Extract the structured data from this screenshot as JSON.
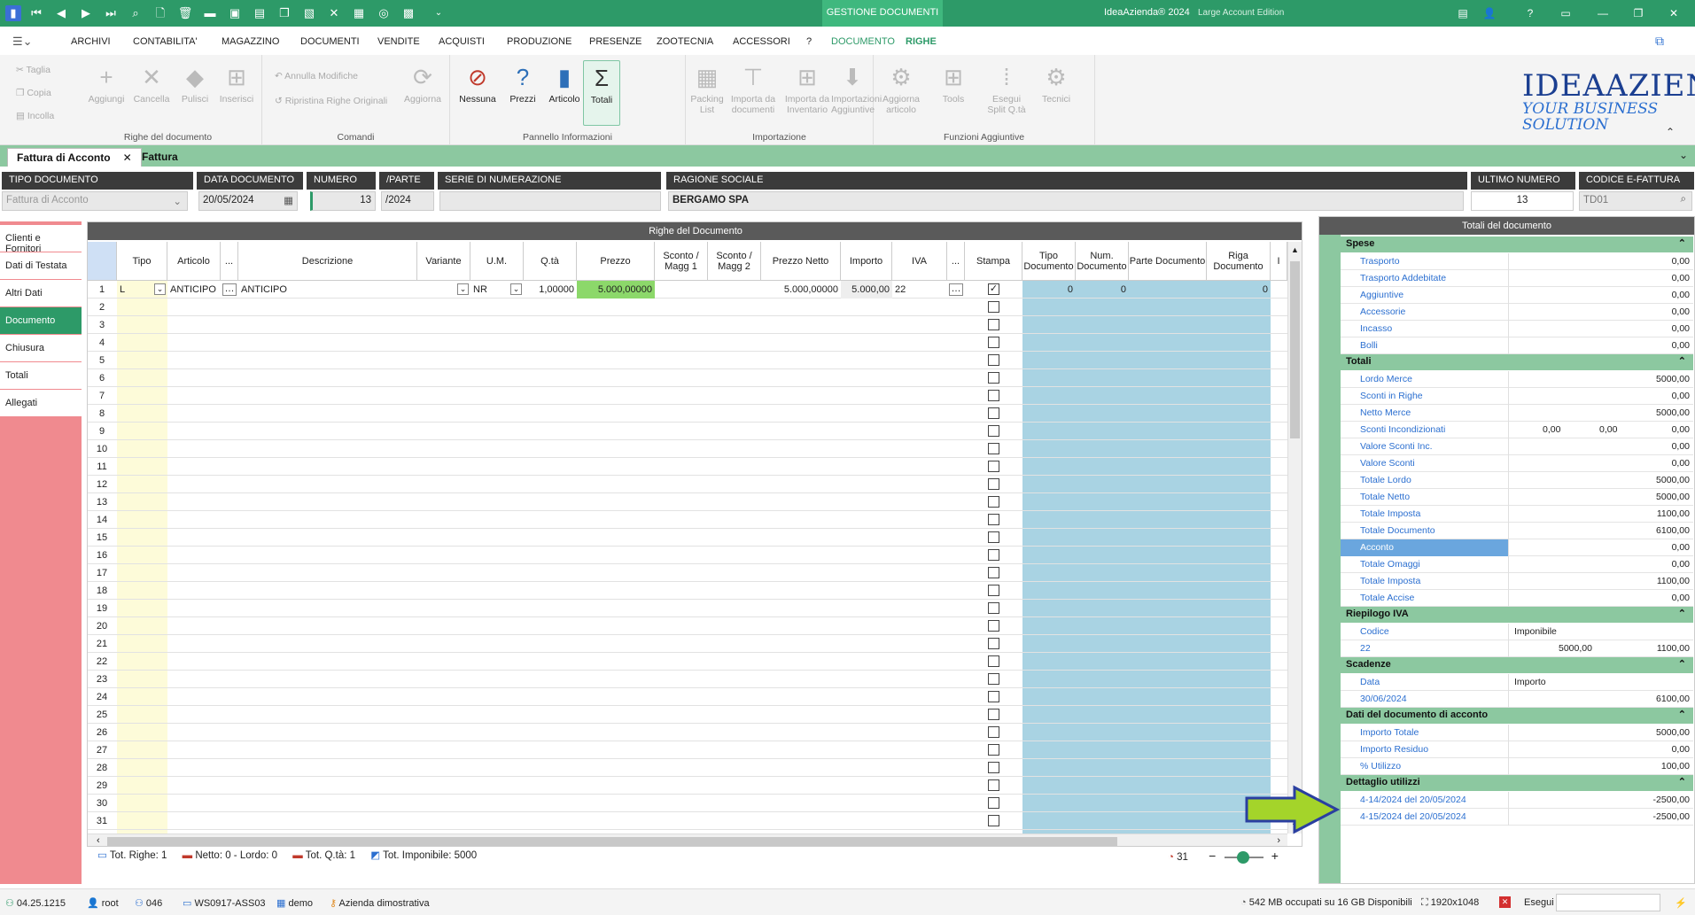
{
  "titlebar": {
    "context_tab": "GESTIONE DOCUMENTI",
    "app_title": "IdeaAzienda® 2024",
    "edition": "Large Account Edition"
  },
  "menu": {
    "items": [
      "ARCHIVI",
      "CONTABILITA'",
      "MAGAZZINO",
      "DOCUMENTI",
      "VENDITE",
      "ACQUISTI",
      "PRODUZIONE",
      "PRESENZE",
      "ZOOTECNIA",
      "ACCESSORI",
      "?",
      "DOCUMENTO",
      "RIGHE"
    ]
  },
  "ribbon": {
    "clipboard": [
      "Taglia",
      "Copia",
      "Incolla"
    ],
    "righe_buttons": [
      "Aggiungi",
      "Cancella",
      "Pulisci",
      "Inserisci"
    ],
    "righe_group": "Righe del documento",
    "comandi": [
      "Annulla Modifiche",
      "Ripristina Righe Originali",
      "Aggiorna"
    ],
    "comandi_group": "Comandi",
    "pannello_buttons": [
      "Nessuna",
      "Prezzi",
      "Articolo",
      "Totali"
    ],
    "pannello_group": "Pannello Informazioni",
    "import_buttons": [
      "Packing List",
      "Importa da documenti",
      "Importa da Inventario",
      "Importazioni Aggiuntive"
    ],
    "import_group": "Importazione",
    "funzioni_buttons": [
      "Aggiorna articolo",
      "Tools",
      "Esegui Split Q.tà",
      "Tecnici"
    ],
    "funzioni_group": "Funzioni Aggiuntive",
    "logo_line1": "IDEAAZIENDA",
    "logo_line2": "YOUR BUSINESS SOLUTION"
  },
  "tabs": [
    "Fattura di Acconto",
    "Fattura"
  ],
  "header": {
    "tipo_documento_label": "TIPO DOCUMENTO",
    "tipo_documento_value": "Fattura di Acconto",
    "data_documento_label": "DATA DOCUMENTO",
    "data_documento_value": "20/05/2024",
    "numero_label": "NUMERO",
    "numero_value": "13",
    "parte_label": "/PARTE",
    "parte_value": "/2024",
    "serie_label": "SERIE DI NUMERAZIONE",
    "serie_value": "",
    "ragione_label": "RAGIONE SOCIALE",
    "ragione_value": "BERGAMO SPA",
    "ultimo_label": "ULTIMO NUMERO",
    "ultimo_value": "13",
    "efattura_label": "CODICE E-FATTURA",
    "efattura_value": "TD01"
  },
  "sidebar": [
    "Clienti e Fornitori",
    "Dati di Testata",
    "Altri Dati",
    "Documento",
    "Chiusura",
    "Totali",
    "Allegati"
  ],
  "grid": {
    "title": "Righe del Documento",
    "columns": [
      "Tipo",
      "Articolo",
      "...",
      "Descrizione",
      "Variante",
      "U.M.",
      "Q.tà",
      "Prezzo",
      "Sconto / Magg 1",
      "Sconto / Magg 2",
      "Prezzo Netto",
      "Importo",
      "IVA",
      "...",
      "Stampa",
      "Tipo Documento",
      "Num. Documento",
      "Parte Documento",
      "Riga Documento",
      "I"
    ],
    "row1": {
      "tipo": "L",
      "articolo": "ANTICIPO",
      "descrizione": "ANTICIPO",
      "um": "NR",
      "qta": "1,00000",
      "prezzo": "5.000,00000",
      "prezzo_netto": "5.000,00000",
      "importo": "5.000,00",
      "iva": "22",
      "tipo_doc": "0",
      "num_doc": "0",
      "riga_doc": "0"
    },
    "row_count": 31
  },
  "status": {
    "tot_righe": "Tot. Righe: 1",
    "netto_lordo": "Netto: 0 - Lordo: 0",
    "tot_qta": "Tot. Q.tà: 1",
    "tot_imponibile": "Tot. Imponibile: 5000",
    "counter": "31"
  },
  "totali": {
    "title": "Totali del documento",
    "spese_title": "Spese",
    "spese": [
      {
        "label": "Trasporto",
        "value": "0,00"
      },
      {
        "label": "Trasporto Addebitate",
        "value": "0,00"
      },
      {
        "label": "Aggiuntive",
        "value": "0,00"
      },
      {
        "label": "Accessorie",
        "value": "0,00"
      },
      {
        "label": "Incasso",
        "value": "0,00"
      },
      {
        "label": "Bolli",
        "value": "0,00"
      }
    ],
    "totali_title": "Totali",
    "totali": [
      {
        "label": "Lordo Merce",
        "value": "5000,00"
      },
      {
        "label": "Sconti in Righe",
        "value": "0,00"
      },
      {
        "label": "Netto Merce",
        "value": "5000,00"
      },
      {
        "label": "Sconti Incondizionati",
        "value": "0,00",
        "v1": "0,00",
        "v2": "0,00"
      },
      {
        "label": "Valore Sconti Inc.",
        "value": "0,00"
      },
      {
        "label": "Valore Sconti",
        "value": "0,00"
      },
      {
        "label": "Totale Lordo",
        "value": "5000,00"
      },
      {
        "label": "Totale Netto",
        "value": "5000,00"
      },
      {
        "label": "Totale Imposta",
        "value": "1100,00"
      },
      {
        "label": "Totale Documento",
        "value": "6100,00"
      },
      {
        "label": "Acconto",
        "value": "0,00"
      },
      {
        "label": "Totale Omaggi",
        "value": "0,00"
      },
      {
        "label": "Totale Imposta",
        "value": "1100,00"
      },
      {
        "label": "Totale Accise",
        "value": "0,00"
      }
    ],
    "iva_title": "Riepilogo IVA",
    "iva_head": {
      "label": "Codice",
      "col": "Imponibile"
    },
    "iva_row": {
      "label": "22",
      "imponibile": "5000,00",
      "imposta": "1100,00"
    },
    "scad_title": "Scadenze",
    "scad_head": {
      "label": "Data",
      "col": "Importo"
    },
    "scad_row": {
      "label": "30/06/2024",
      "value": "6100,00"
    },
    "acconto_title": "Dati del documento di acconto",
    "acconto": [
      {
        "label": "Importo Totale",
        "value": "5000,00"
      },
      {
        "label": "Importo Residuo",
        "value": "0,00"
      },
      {
        "label": "% Utilizzo",
        "value": "100,00"
      }
    ],
    "utilizzi_title": "Dettaglio utilizzi",
    "utilizzi": [
      {
        "label": "4-14/2024 del 20/05/2024",
        "value": "-2500,00"
      },
      {
        "label": "4-15/2024 del 20/05/2024",
        "value": "-2500,00"
      }
    ]
  },
  "bottom": {
    "version": "04.25.1215",
    "user": "root",
    "code": "046",
    "workstation": "WS0917-ASS03",
    "db": "demo",
    "company": "Azienda dimostrativa",
    "memory": "542 MB occupati su 16 GB Disponibili",
    "resolution": "1920x1048",
    "exec_label": "Esegui"
  }
}
